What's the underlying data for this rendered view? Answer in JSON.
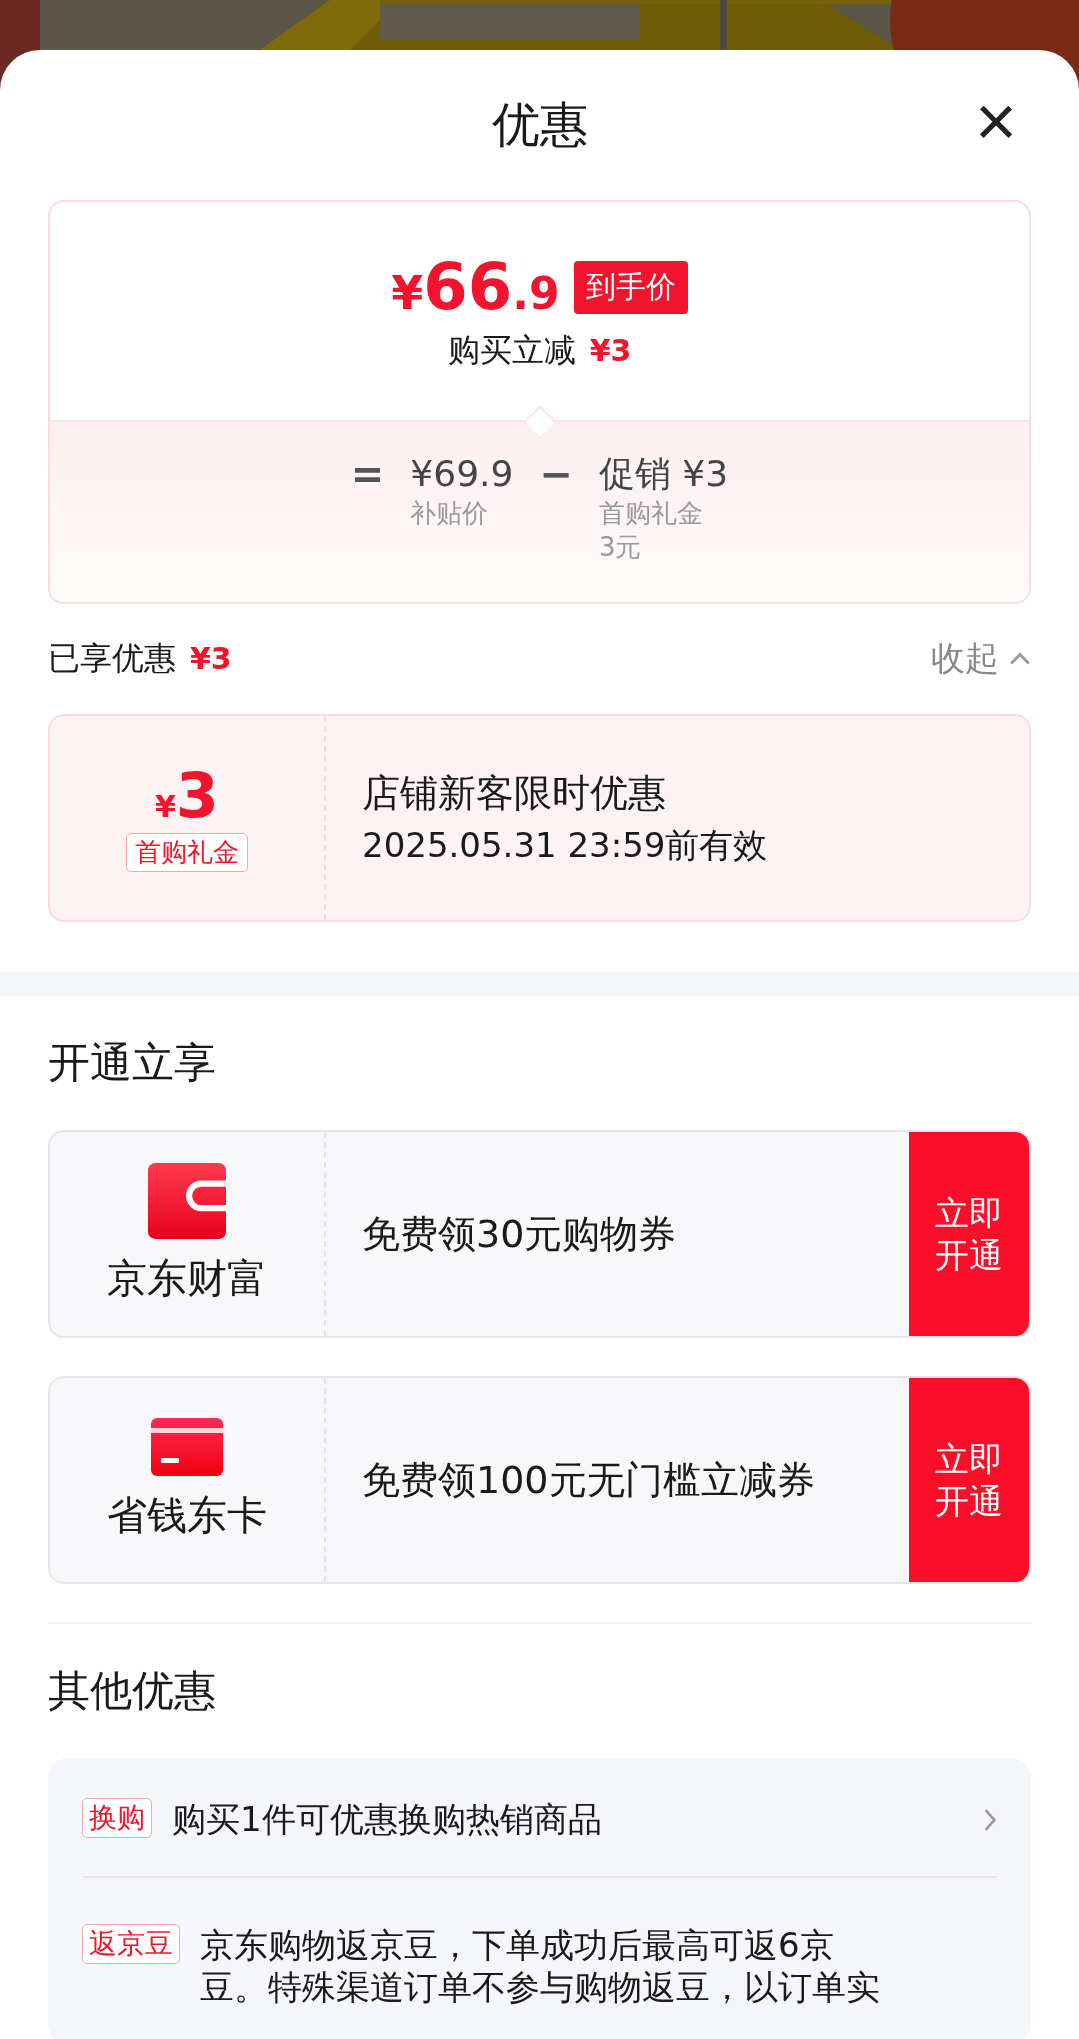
{
  "sheet": {
    "title": "优惠",
    "close": "×"
  },
  "price_summary": {
    "currency": "¥",
    "integer": "66",
    "decimal": ".9",
    "tag": "到手价",
    "discount_label": "购买立减",
    "discount_amount": "¥3",
    "breakdown": [
      {
        "operator": "=",
        "value": "¥69.9",
        "note": [
          "补贴价"
        ]
      },
      {
        "operator": "−",
        "value": "促销 ¥3",
        "note": [
          "首购礼金",
          "3元"
        ]
      }
    ]
  },
  "applied": {
    "label": "已享优惠",
    "amount": "¥3",
    "toggle": "收起",
    "expanded": true
  },
  "coupons": [
    {
      "currency": "¥",
      "amount": "3",
      "tag": "首购礼金",
      "title": "店铺新客限时优惠",
      "validity": "2025.05.31 23:59前有效"
    }
  ],
  "membership": {
    "heading": "开通立享",
    "offers": [
      {
        "kind": "wallet",
        "name": "京东财富",
        "text": "免费领30元购物券",
        "button": "立即开通"
      },
      {
        "kind": "card",
        "name": "省钱东卡",
        "text": "免费领100元无门槛立减券",
        "button": "立即开通"
      }
    ]
  },
  "other": {
    "heading": "其他优惠",
    "items": [
      {
        "kind": "link",
        "tag": "换购",
        "text": "购买1件可优惠换购热销商品"
      },
      {
        "kind": "info",
        "tag": "返京豆",
        "text": "京东购物返京豆，下单成功后最高可返6京豆。特殊渠道订单不参与购物返豆，以订单实"
      }
    ]
  }
}
